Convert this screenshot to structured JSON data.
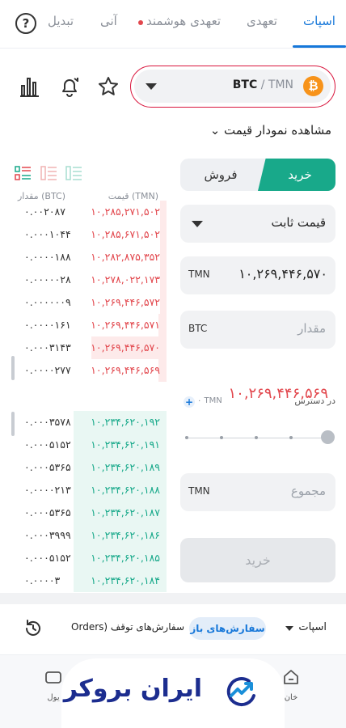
{
  "tabs": [
    "اسپات",
    "تعهدی",
    "تعهدی هوشمند",
    "آنی",
    "تبدیل"
  ],
  "market": {
    "base": "BTC",
    "sep": " / ",
    "quote": "TMN",
    "coin_symbol": "₿"
  },
  "chart_toggle": "مشاهده نمودار قیمت ⌄",
  "orderbook": {
    "price_header": "قیمت (TMN)",
    "amount_header": "مقدار (BTC)",
    "asks": [
      {
        "price": "۱۰,۲۸۵,۲۷۱,۵۰۲",
        "amount": "۰.۰۰۲۰۸۷",
        "depth": 0.04
      },
      {
        "price": "۱۰,۲۸۵,۶۷۱,۵۰۲",
        "amount": "۰.۰۰۰۱۰۴۴",
        "depth": 0.04
      },
      {
        "price": "۱۰,۲۸۲,۸۷۵,۳۵۲",
        "amount": "۰.۰۰۰۰۱۸۸",
        "depth": 0.04
      },
      {
        "price": "۱۰,۲۷۸,۰۲۲,۱۷۳",
        "amount": "۰.۰۰۰۰۰۲۸",
        "depth": 0.04
      },
      {
        "price": "۱۰,۲۶۹,۴۴۶,۵۷۲",
        "amount": "۰.۰۰۰۰۰۰۹",
        "depth": 0.04
      },
      {
        "price": "۱۰,۲۶۹,۴۴۶,۵۷۱",
        "amount": "۰.۰۰۰۰۱۶۱",
        "depth": 0.05
      },
      {
        "price": "۱۰,۲۶۹,۴۴۶,۵۷۰",
        "amount": "۰.۰۰۰۳۱۴۳",
        "depth": 0.45
      },
      {
        "price": "۱۰,۲۶۹,۴۴۶,۵۶۹",
        "amount": "۰.۰۰۰۰۲۷۷",
        "depth": 0.05
      }
    ],
    "last_price": "۱۰,۲۶۹,۴۴۶,۵۶۹",
    "bids": [
      {
        "price": "۱۰,۲۳۴,۶۲۰,۱۹۲",
        "amount": "۰.۰۰۰۳۵۷۸",
        "depth": 0.56
      },
      {
        "price": "۱۰,۲۳۴,۶۲۰,۱۹۱",
        "amount": "۰.۰۰۰۵۱۵۲",
        "depth": 0.56
      },
      {
        "price": "۱۰,۲۳۴,۶۲۰,۱۸۹",
        "amount": "۰.۰۰۰۵۳۶۵",
        "depth": 0.56
      },
      {
        "price": "۱۰,۲۳۴,۶۲۰,۱۸۸",
        "amount": "۰.۰۰۰۰۲۱۳",
        "depth": 0.56
      },
      {
        "price": "۱۰,۲۳۴,۶۲۰,۱۸۷",
        "amount": "۰.۰۰۰۵۳۶۵",
        "depth": 0.56
      },
      {
        "price": "۱۰,۲۳۴,۶۲۰,۱۸۶",
        "amount": "۰.۰۰۰۳۹۹۹",
        "depth": 0.56
      },
      {
        "price": "۱۰,۲۳۴,۶۲۰,۱۸۵",
        "amount": "۰.۰۰۰۵۱۵۲",
        "depth": 0.56
      },
      {
        "price": "۱۰,۲۳۴,۶۲۰,۱۸۴",
        "amount": "۰.۰۰۰۰۳",
        "depth": 0.56
      }
    ]
  },
  "form": {
    "buy_label": "خرید",
    "sell_label": "فروش",
    "order_type": "قیمت ثابت",
    "price_unit": "TMN",
    "price_value": "۱۰,۲۶۹,۴۴۶,۵۷۰",
    "amount_unit": "BTC",
    "amount_placeholder": "مقدار",
    "available_label": "در دسترس",
    "available_value": "۰ TMN",
    "total_unit": "TMN",
    "total_placeholder": "مجموع",
    "submit_label": "خرید"
  },
  "bottom_tabs": {
    "spot": "اسپات",
    "open_orders": "سفارش‌های باز",
    "stop_orders": "سفارش‌های توقف (Orders"
  },
  "nav": {
    "home": "خان",
    "wallet": "یول"
  },
  "logo": {
    "text": "ایران بروکر"
  },
  "colors": {
    "accent": "#1677d9",
    "buy": "#18a98a",
    "sell": "#e2474d",
    "alert": "#d9163d"
  }
}
